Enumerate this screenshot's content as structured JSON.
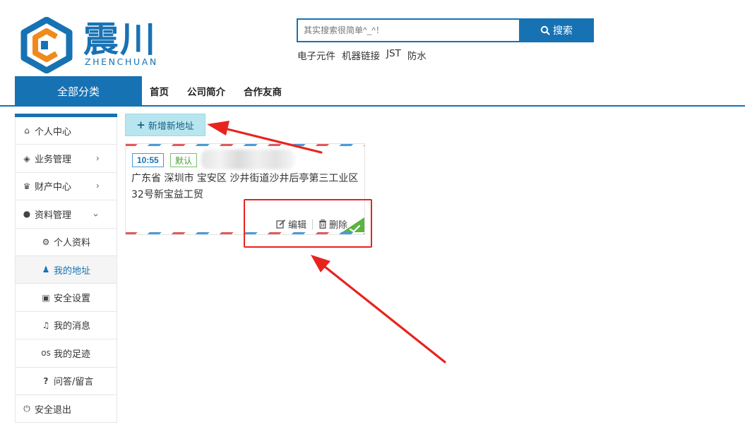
{
  "header": {
    "logo_cn": "震川",
    "logo_en": "ZHENCHUAN",
    "search_placeholder": "其实搜索很简单^_^！",
    "search_button": "搜索",
    "hot_words": [
      "电子元件",
      "机器链接",
      "JST",
      "防水"
    ]
  },
  "nav": {
    "all_categories": "全部分类",
    "links": [
      "首页",
      "公司简介",
      "合作友商"
    ]
  },
  "sidebar": {
    "items": [
      {
        "label": "个人中心",
        "icon": "home-icon",
        "glyph": "⌂"
      },
      {
        "label": "业务管理",
        "icon": "cube-icon",
        "glyph": "◈",
        "chevron": "›"
      },
      {
        "label": "财产中心",
        "icon": "trophy-icon",
        "glyph": "♛",
        "chevron": "›"
      },
      {
        "label": "资料管理",
        "icon": "user-icon",
        "glyph": "●",
        "chevron": "⌄"
      },
      {
        "label": "个人资料",
        "icon": "gear-icon",
        "glyph": "⚙"
      },
      {
        "label": "我的地址",
        "icon": "location-icon",
        "glyph": "♟"
      },
      {
        "label": "安全设置",
        "icon": "lock-icon",
        "glyph": "▣"
      },
      {
        "label": "我的消息",
        "icon": "bell-icon",
        "glyph": "♫"
      },
      {
        "label": "我的足迹",
        "icon": "footprint-icon",
        "glyph": "os"
      },
      {
        "label": "问答/留言",
        "icon": "question-icon",
        "glyph": "?"
      },
      {
        "label": "安全退出",
        "icon": "power-icon",
        "glyph": "⏻"
      }
    ]
  },
  "content": {
    "add_address_button": "新增新地址",
    "address_card": {
      "time_tag": "10:55",
      "default_tag": "默认",
      "address_line1": "广东省 深圳市 宝安区 沙井街道沙井后亭第三工业区",
      "address_line2": "32号新宝益工贸",
      "edit_label": "编辑",
      "delete_label": "删除"
    }
  },
  "colors": {
    "brand_blue": "#1772b4",
    "add_button_bg": "#b7e6ef",
    "annotation_red": "#e8231e",
    "default_green": "#7cc06b"
  }
}
